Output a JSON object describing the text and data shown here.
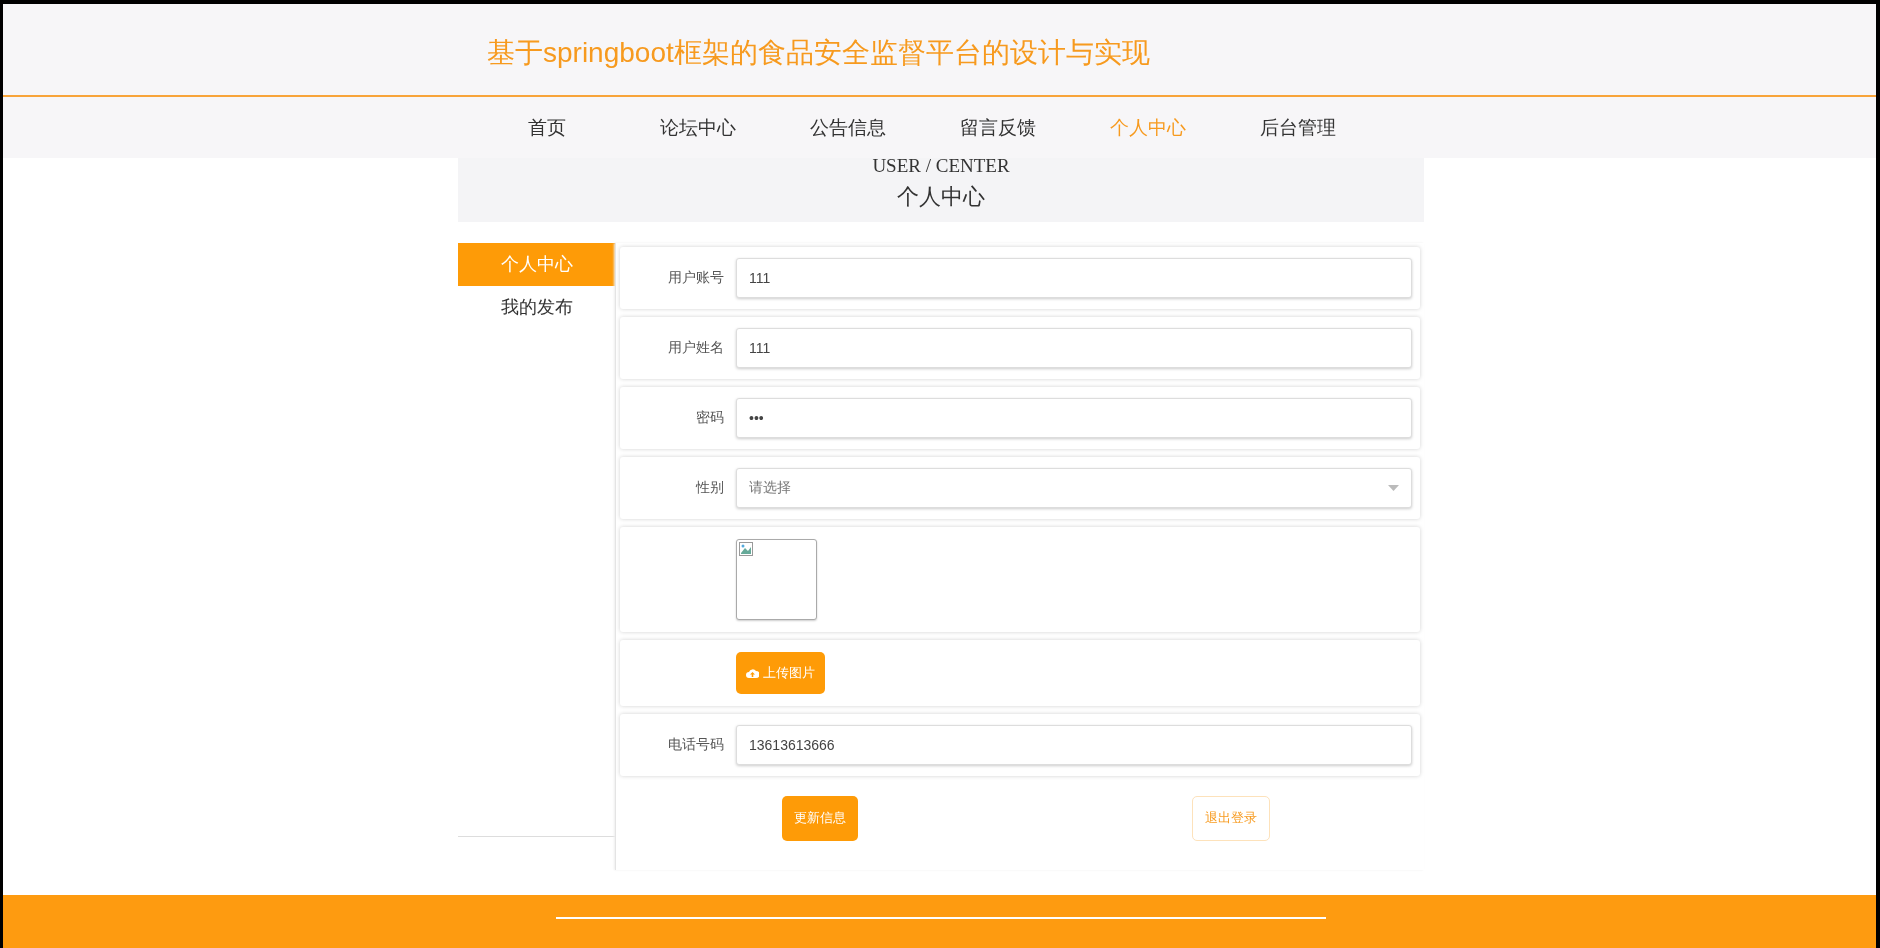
{
  "header": {
    "title": "基于springboot框架的食品安全监督平台的设计与实现"
  },
  "nav": [
    {
      "label": "首页",
      "selected": false
    },
    {
      "label": "论坛中心",
      "selected": false
    },
    {
      "label": "公告信息",
      "selected": false
    },
    {
      "label": "留言反馈",
      "selected": false
    },
    {
      "label": "个人中心",
      "selected": true
    },
    {
      "label": "后台管理",
      "selected": false
    }
  ],
  "banner": {
    "subtitle": "USER / CENTER",
    "title": "个人中心"
  },
  "sidebar": {
    "items": [
      {
        "label": "个人中心",
        "selected": true
      },
      {
        "label": "我的发布",
        "selected": false
      }
    ]
  },
  "form": {
    "rows": [
      {
        "kind": "text",
        "label": "用户账号",
        "value": "111"
      },
      {
        "kind": "text",
        "label": "用户姓名",
        "value": "111"
      },
      {
        "kind": "password",
        "label": "密码",
        "value": "•••"
      },
      {
        "kind": "select",
        "label": "性别",
        "placeholder": "请选择"
      },
      {
        "kind": "image"
      },
      {
        "kind": "upload",
        "button": "上传图片"
      },
      {
        "kind": "text",
        "label": "电话号码",
        "value": "13613613666"
      }
    ],
    "actions": [
      {
        "kind": "primary",
        "label": "更新信息"
      },
      {
        "kind": "outline",
        "label": "退出登录"
      }
    ]
  }
}
